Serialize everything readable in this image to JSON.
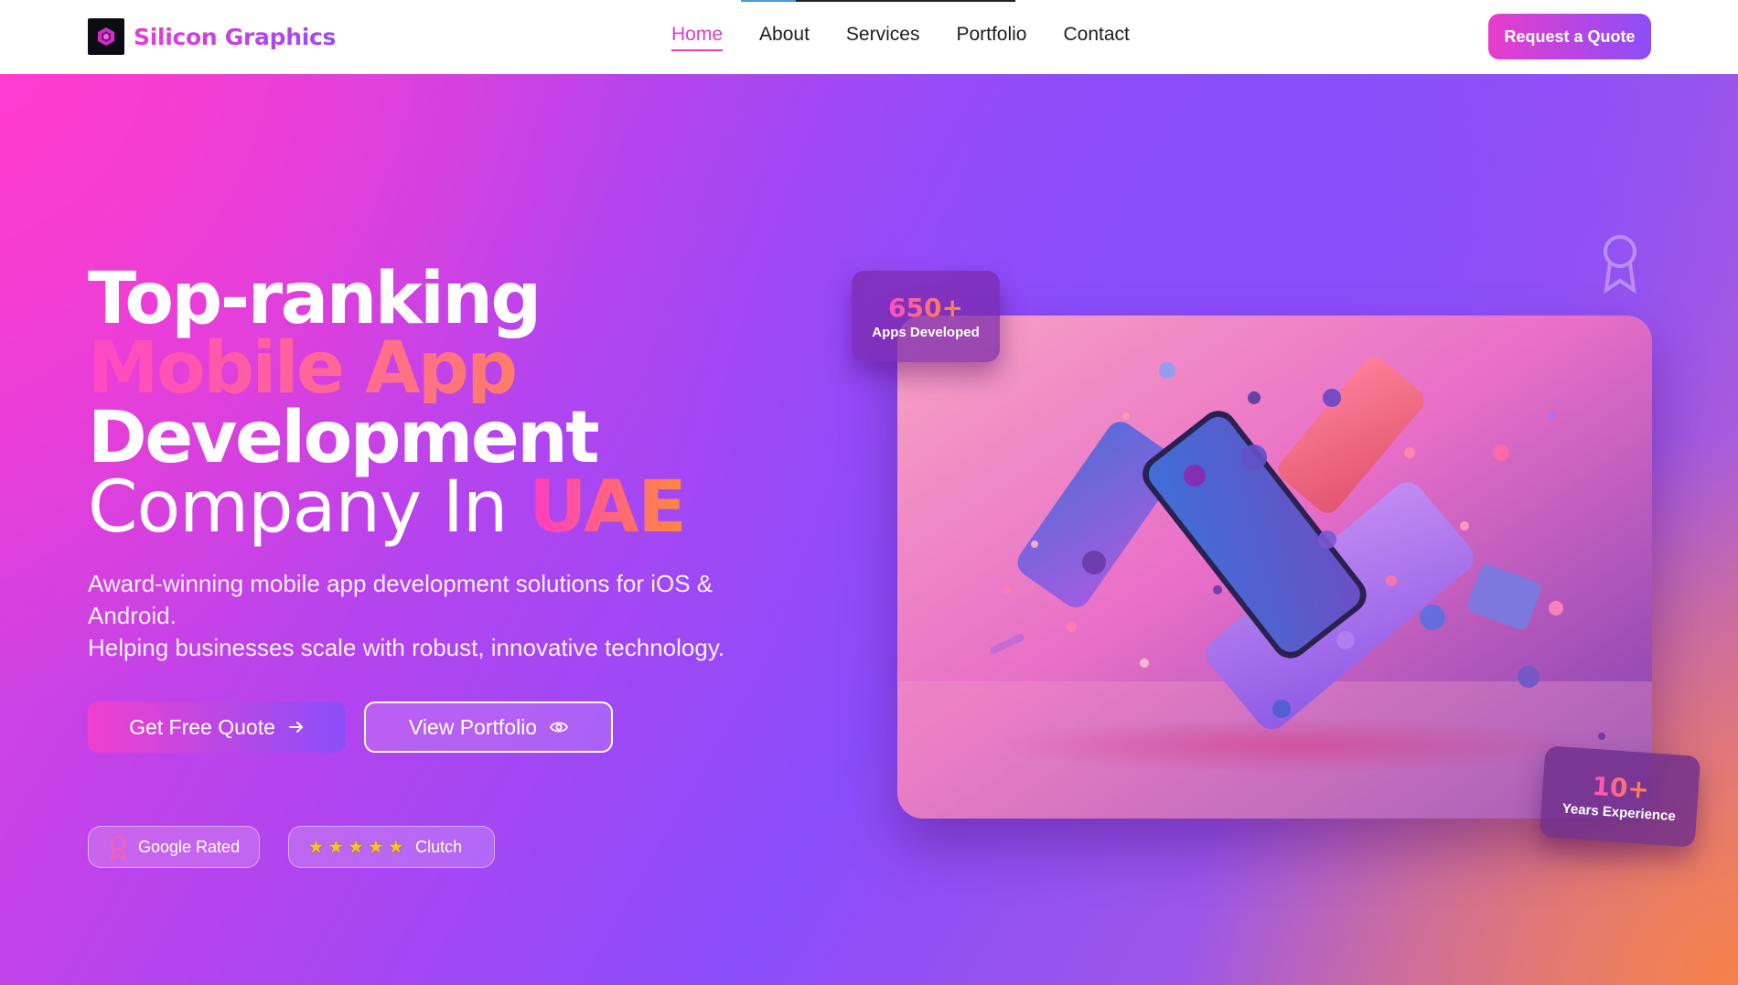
{
  "nav": {
    "brand": "Silicon Graphics",
    "links": [
      {
        "label": "Home",
        "active": true
      },
      {
        "label": "About",
        "active": false
      },
      {
        "label": "Services",
        "active": false
      },
      {
        "label": "Portfolio",
        "active": false
      },
      {
        "label": "Contact",
        "active": false
      }
    ],
    "cta": "Request a Quote",
    "scroll_progress": 0.2
  },
  "hero": {
    "headline": {
      "line1": "Top-ranking",
      "line2": "Mobile App",
      "line3": "Development",
      "line4_prefix": "Company In ",
      "line4_highlight": "UAE"
    },
    "subtitle_line1": "Award-winning mobile app development solutions for iOS & Android.",
    "subtitle_line2": "Helping businesses scale with robust, innovative technology.",
    "primary_cta": "Get Free Quote",
    "secondary_cta": "View Portfolio",
    "badges": {
      "google": "Google Rated",
      "clutch": "Clutch",
      "clutch_stars": 5
    },
    "stats": {
      "apps_value": "650+",
      "apps_label": "Apps Developed",
      "years_value": "10+",
      "years_label": "Years Experience"
    }
  },
  "colors": {
    "brand_pink": "#e83ad6",
    "brand_purple": "#8b4ef8",
    "accent_orange": "#ff8a3c"
  }
}
